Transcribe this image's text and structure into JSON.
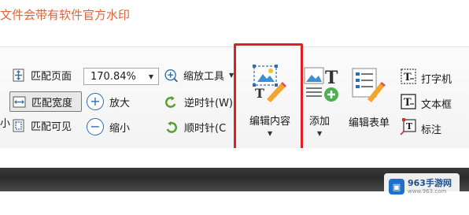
{
  "notice": {
    "text": "文件会带有软件官方水印"
  },
  "ribbon": {
    "fit_page": "匹配页面",
    "fit_width": "匹配宽度",
    "fit_visible": "匹配可见",
    "zoom_value": "170.84%",
    "zoom_tools": "缩放工具",
    "zoom_in": "放大",
    "zoom_out": "缩小",
    "rotate_ccw": "逆时针(W)",
    "rotate_cw": "顺时针(C",
    "edit_content": "编辑内容",
    "add": "添加",
    "edit_form": "编辑表单",
    "typewriter": "打字机",
    "textbox": "文本框",
    "callout": "标注",
    "left_cut_label": "小"
  },
  "watermark": {
    "brand": "963手游网",
    "url": "www.963.com"
  },
  "colors": {
    "notice": "#e2633a",
    "highlight": "#e02020",
    "accent": "#2e6db3",
    "rotate": "#5a9e2f"
  }
}
